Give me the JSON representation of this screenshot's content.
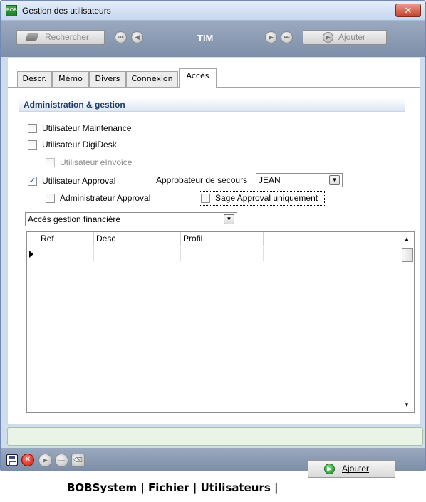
{
  "window": {
    "title": "Gestion des utilisateurs",
    "close_label": "✕",
    "app_icon_text": "BOB"
  },
  "toolbar": {
    "search_label": "Rechercher",
    "current_user": "TIM",
    "add_label": "Ajouter"
  },
  "tabs": [
    {
      "label": "Descr.",
      "active": false
    },
    {
      "label": "Mémo",
      "active": false
    },
    {
      "label": "Divers",
      "active": false
    },
    {
      "label": "Connexion",
      "active": false
    },
    {
      "label": "Accès",
      "active": true
    }
  ],
  "section": {
    "title": "Administration & gestion"
  },
  "options": {
    "maintenance": {
      "label": "Utilisateur Maintenance",
      "checked": false
    },
    "digidesk": {
      "label": "Utilisateur DigiDesk",
      "checked": false
    },
    "einvoice": {
      "label": "Utilisateur eInvoice",
      "checked": false,
      "enabled": false
    },
    "approval": {
      "label": "Utilisateur Approval",
      "checked": true
    },
    "approval_admin": {
      "label": "Administrateur Approval",
      "checked": false
    },
    "sage_only": {
      "label": "Sage Approval uniquement",
      "checked": false
    }
  },
  "backup_approver": {
    "label": "Approbateur de secours",
    "value": "JEAN"
  },
  "access_select": {
    "value": "Accès gestion financière"
  },
  "grid": {
    "columns": [
      "Ref",
      "Desc",
      "Profil"
    ],
    "rows": []
  },
  "caption": {
    "path": "BOBSystem | Fichier | Utilisateurs |",
    "button_label": "Ajouter"
  },
  "colors": {
    "accent": "#7d8ea8",
    "status_green": "#eaf4e6",
    "header_text": "#1f3b63"
  }
}
